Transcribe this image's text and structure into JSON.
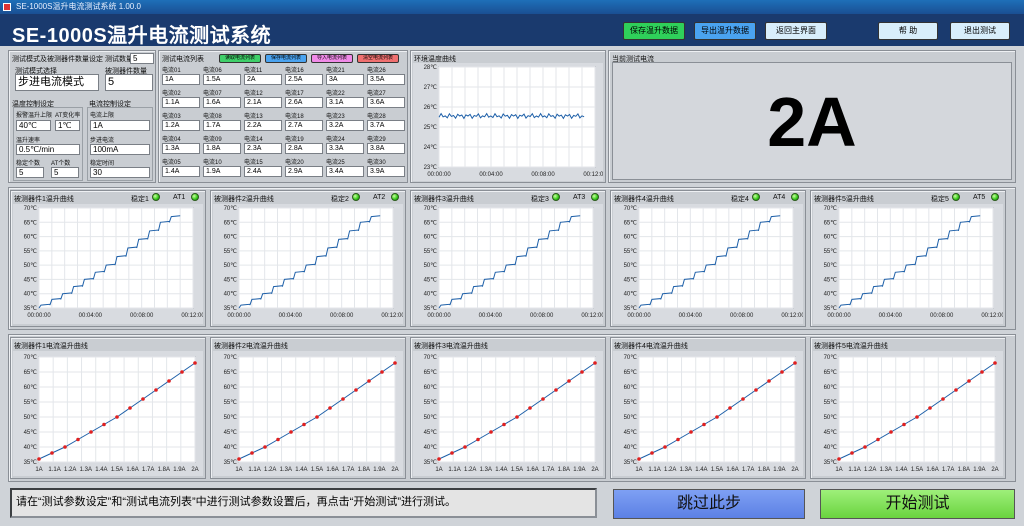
{
  "window": {
    "title": "SE-1000S温升电流测试系统 1.00.0"
  },
  "header": {
    "title": "SE-1000S温升电流测试系统",
    "buttons": [
      {
        "label": "保存温升数据"
      },
      {
        "label": "导出温升数据"
      },
      {
        "label": "返回主界面"
      },
      {
        "label": "帮 助"
      },
      {
        "label": "退出测试"
      }
    ]
  },
  "settings": {
    "section_label": "测试模式及被测器件数量设定",
    "count_label": "测试数量",
    "count_value": "5",
    "mode_label": "测试模式选择",
    "mode_value": "步进电流模式",
    "device_count_label": "被测器件数量",
    "device_count_value": "5",
    "temp_section_label": "温度控制设定",
    "cur_section_label": "电流控制设定",
    "temp_fields": [
      {
        "label": "报警温升上限",
        "value": "40℃"
      },
      {
        "label": "AT变化率",
        "value": "1℃"
      },
      {
        "label": "温升速率",
        "value": "0.5℃/min"
      },
      {
        "label": "稳定个数",
        "value": "5"
      },
      {
        "label": "AT个数",
        "value": "5"
      }
    ],
    "cur_fields": [
      {
        "label": "电流上限",
        "value": "1A"
      },
      {
        "label": "步进电流",
        "value": "100mA"
      },
      {
        "label": "稳定时间",
        "value": "30"
      }
    ]
  },
  "current_table": {
    "label": "测试电流列表",
    "buttons": [
      "读取电流列表",
      "保存电流列表",
      "导入电流列表",
      "清空电流列表"
    ],
    "cells": [
      {
        "label": "电流01",
        "value": "1A"
      },
      {
        "label": "电流06",
        "value": "1.5A"
      },
      {
        "label": "电流11",
        "value": "2A"
      },
      {
        "label": "电流16",
        "value": "2.5A"
      },
      {
        "label": "电流21",
        "value": "3A"
      },
      {
        "label": "电流26",
        "value": "3.5A"
      },
      {
        "label": "电流02",
        "value": "1.1A"
      },
      {
        "label": "电流07",
        "value": "1.6A"
      },
      {
        "label": "电流12",
        "value": "2.1A"
      },
      {
        "label": "电流17",
        "value": "2.6A"
      },
      {
        "label": "电流22",
        "value": "3.1A"
      },
      {
        "label": "电流27",
        "value": "3.6A"
      },
      {
        "label": "电流03",
        "value": "1.2A"
      },
      {
        "label": "电流08",
        "value": "1.7A"
      },
      {
        "label": "电流13",
        "value": "2.2A"
      },
      {
        "label": "电流18",
        "value": "2.7A"
      },
      {
        "label": "电流23",
        "value": "3.2A"
      },
      {
        "label": "电流28",
        "value": "3.7A"
      },
      {
        "label": "电流04",
        "value": "1.3A"
      },
      {
        "label": "电流09",
        "value": "1.8A"
      },
      {
        "label": "电流14",
        "value": "2.3A"
      },
      {
        "label": "电流19",
        "value": "2.8A"
      },
      {
        "label": "电流24",
        "value": "3.3A"
      },
      {
        "label": "电流29",
        "value": "3.8A"
      },
      {
        "label": "电流05",
        "value": "1.4A"
      },
      {
        "label": "电流10",
        "value": "1.9A"
      },
      {
        "label": "电流15",
        "value": "2.4A"
      },
      {
        "label": "电流20",
        "value": "2.9A"
      },
      {
        "label": "电流25",
        "value": "3.4A"
      },
      {
        "label": "电流30",
        "value": "3.9A"
      }
    ]
  },
  "ambient": {
    "label": "环境温度曲线"
  },
  "current_display": {
    "label": "当前测试电流",
    "value": "2A"
  },
  "temp_panels": [
    {
      "title": "被测器件1温升曲线",
      "stable_label": "稳定1",
      "at_label": "AT1"
    },
    {
      "title": "被测器件2温升曲线",
      "stable_label": "稳定2",
      "at_label": "AT2"
    },
    {
      "title": "被测器件3温升曲线",
      "stable_label": "稳定3",
      "at_label": "AT3"
    },
    {
      "title": "被测器件4温升曲线",
      "stable_label": "稳定4",
      "at_label": "AT4"
    },
    {
      "title": "被测器件5温升曲线",
      "stable_label": "稳定5",
      "at_label": "AT5"
    }
  ],
  "rise_panels": [
    {
      "title": "被测器件1电流温升曲线"
    },
    {
      "title": "被测器件2电流温升曲线"
    },
    {
      "title": "被测器件3电流温升曲线"
    },
    {
      "title": "被测器件4电流温升曲线"
    },
    {
      "title": "被测器件5电流温升曲线"
    }
  ],
  "footer": {
    "message": "请在“测试参数设定”和“测试电流列表”中进行测试参数设置后，再点击“开始测试”进行测试。",
    "skip_label": "跳过此步",
    "start_label": "开始测试"
  },
  "chart_data": [
    {
      "type": "line",
      "name": "ambient",
      "ylim": [
        23,
        28
      ],
      "yticks": [
        "28℃",
        "27℃",
        "26℃",
        "25℃",
        "24℃",
        "23℃"
      ],
      "xticks": [
        "00:00:00",
        "00:04:00",
        "00:08:00",
        "00:12:00"
      ],
      "y_mean": 25.55,
      "y_amplitude": 0.12
    },
    {
      "type": "line",
      "name": "device-temperature",
      "ylim": [
        35,
        70
      ],
      "yticks": [
        "70℃",
        "65℃",
        "60℃",
        "55℃",
        "50℃",
        "45℃",
        "40℃",
        "35℃"
      ],
      "xticks": [
        "00:00:00",
        "00:04:00",
        "00:08:00",
        "00:12:00"
      ],
      "x_end_minutes": 11,
      "steps": [
        36,
        38,
        40,
        42.5,
        45,
        47.5,
        50,
        53,
        56,
        59,
        62,
        65,
        67
      ],
      "applies_to": [
        "device-1",
        "device-2",
        "device-3",
        "device-4",
        "device-5"
      ]
    },
    {
      "type": "line",
      "name": "current-temperature-rise",
      "ylim": [
        35,
        70
      ],
      "yticks": [
        "70℃",
        "65℃",
        "60℃",
        "55℃",
        "50℃",
        "45℃",
        "40℃",
        "35℃"
      ],
      "categories": [
        "1A",
        "1.1A",
        "1.2A",
        "1.3A",
        "1.4A",
        "1.5A",
        "1.6A",
        "1.7A",
        "1.8A",
        "1.9A",
        "2A"
      ],
      "values": [
        36,
        38,
        40,
        42.5,
        45,
        47.5,
        50,
        53,
        56,
        59,
        62,
        65,
        68
      ],
      "applies_to": [
        "device-1",
        "device-2",
        "device-3",
        "device-4",
        "device-5"
      ]
    }
  ]
}
